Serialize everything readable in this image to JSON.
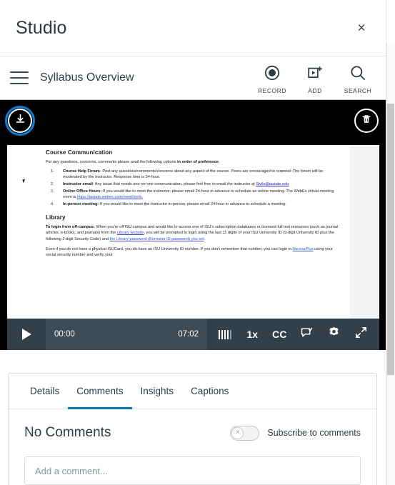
{
  "window": {
    "app_title": "Studio",
    "close_label": "×"
  },
  "subnav": {
    "menu_icon": "hamburger-menu-icon",
    "title": "Syllabus Overview",
    "actions": [
      {
        "label": "RECORD",
        "icon": "record-icon"
      },
      {
        "label": "ADD",
        "icon": "add-media-icon"
      },
      {
        "label": "SEARCH",
        "icon": "search-icon"
      }
    ]
  },
  "video": {
    "download_icon": "download-icon",
    "delete_icon": "trash-icon",
    "focus_ring_color": "#0c7cd5",
    "document": {
      "heading": "Course Communication",
      "intro_prefix": "For any questions, concerns, comments please avail the following options ",
      "intro_bold": "in order of preference",
      "intro_suffix": ":",
      "items": [
        {
          "bold": "Course Help Forum",
          "text": "- Post any questions/comments/concerns about any aspect of the course. Peers are encouraged to respond. The forum will be moderated by the Instructor. Response time is 24-hour."
        },
        {
          "bold": "Instructor email",
          "text": ": Any issue that needs one-on-one communication, please feel free to email the instructor at ",
          "link": "Sivils@iastate.edu"
        },
        {
          "bold": "Online Office Hours:",
          "text": " If you would like to meet the instructor, please email 24-hour in advance to schedule an online meeting. The WebEx virtual meeting room is ",
          "link": "https://iastate.webex.com/meet/sivils."
        },
        {
          "bold": "In-person meeting:",
          "text": " If you would like to meet the Instructor in-person, please email 24-hour in advance to schedule a meeting."
        }
      ],
      "heading2": "Library",
      "library_bold": "To login from off-campus:",
      "library_p1_a": " When you're off ISU campus and would like to access one of ISU's subscription databases or licensed full text resources (such as journal articles, e-books, and journals) from the ",
      "library_link1": "Library website",
      "library_p1_b": ", you will be prompted to login using the last 11 digits of your ISU University ID (9-digit University ID plus the following 2-digit Security Code) and ",
      "library_link2": "the Library password (Borrower ID password) you set",
      "library_p1_c": ".",
      "library_p2_a": "Even if you do not have a physical ISUCard, you do have an ISU University ID number.  If you don't remember that number, you can login to ",
      "library_link3": "AccessPlus",
      "library_p2_b": " using your social security number and verify your"
    },
    "controls": {
      "play_icon": "play-icon",
      "current_time": "00:00",
      "duration": "07:02",
      "volume_icon": "volume-level-icon",
      "speed": "1x",
      "captions": "CC",
      "comment_icon": "comment-check-icon",
      "settings_icon": "gear-icon",
      "fullscreen_icon": "expand-icon"
    }
  },
  "tabs": [
    {
      "label": "Details",
      "active": false
    },
    {
      "label": "Comments",
      "active": true
    },
    {
      "label": "Insights",
      "active": false
    },
    {
      "label": "Captions",
      "active": false
    }
  ],
  "comments_panel": {
    "empty_title": "No Comments",
    "subscribe_label": "Subscribe to comments",
    "subscribe_state": "off",
    "toggle_glyph": "×",
    "input_placeholder": "Add a comment..."
  },
  "accent_color": "#0374b5"
}
